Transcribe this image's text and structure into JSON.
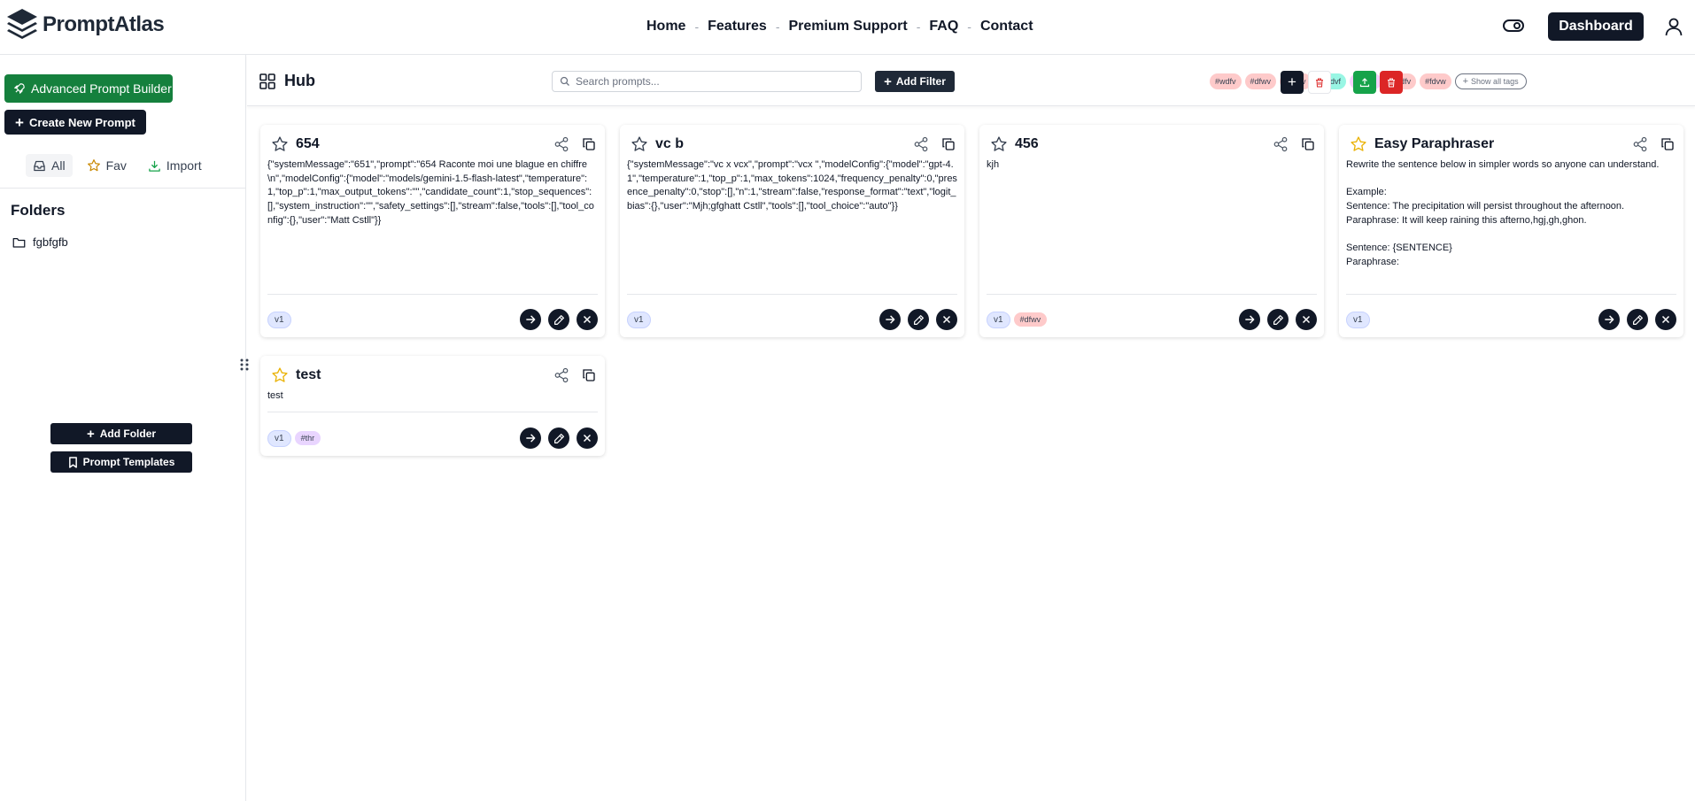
{
  "brand": {
    "name": "PromptAtlas"
  },
  "nav": {
    "links": [
      "Home",
      "Features",
      "Premium Support",
      "FAQ",
      "Contact"
    ],
    "separator": "-",
    "dashboard_label": "Dashboard"
  },
  "sidebar": {
    "advanced_builder_label": "Advanced Prompt Builder",
    "create_prompt_label": "Create New Prompt",
    "tabs": [
      {
        "label": "All",
        "icon": "inbox-icon"
      },
      {
        "label": "Fav",
        "icon": "star-icon"
      },
      {
        "label": "Import",
        "icon": "download-icon"
      }
    ],
    "folders_title": "Folders",
    "folders": [
      "fgbfgfb"
    ],
    "add_folder_label": "Add Folder",
    "templates_label": "Prompt Templates"
  },
  "hub": {
    "title": "Hub",
    "search_placeholder": "Search prompts...",
    "add_filter_label": "Add Filter",
    "tags": [
      {
        "label": "#wdfv",
        "color": "#fecaca"
      },
      {
        "label": "#dfwv",
        "color": "#fecaca"
      },
      {
        "label": "#wdfv",
        "color": "#fecaca"
      },
      {
        "label": "#wdvf",
        "color": "#99f6e4"
      },
      {
        "label": "#dwfv",
        "color": "#f5d0fe"
      },
      {
        "label": "#wdfv",
        "color": "#fecaca"
      },
      {
        "label": "#fdvw",
        "color": "#fecaca"
      }
    ],
    "show_all_label": "Show all tags"
  },
  "cards": [
    {
      "title": "654",
      "favorite": false,
      "body": "{\"systemMessage\":\"651\",\"prompt\":\"654 Raconte moi une blague en chiffre \\n\",\"modelConfig\":{\"model\":\"models/gemini-1.5-flash-latest\",\"temperature\":1,\"top_p\":1,\"max_output_tokens\":\"\",\"candidate_count\":1,\"stop_sequences\":[],\"system_instruction\":\"\",\"safety_settings\":[],\"stream\":false,\"tools\":[],\"tool_config\":{},\"user\":\"Matt Cstll\"}}",
      "version": "v1",
      "tags": []
    },
    {
      "title": "vc b",
      "favorite": false,
      "body": "{\"systemMessage\":\"vc x vcx\",\"prompt\":\"vcx \",\"modelConfig\":{\"model\":\"gpt-4.1\",\"temperature\":1,\"top_p\":1,\"max_tokens\":1024,\"frequency_penalty\":0,\"presence_penalty\":0,\"stop\":[],\"n\":1,\"stream\":false,\"response_format\":\"text\",\"logit_bias\":{},\"user\":\"Mjh;gfghatt Cstll\",\"tools\":[],\"tool_choice\":\"auto\"}}",
      "version": "v1",
      "tags": []
    },
    {
      "title": "456",
      "favorite": false,
      "body": "kjh",
      "version": "v1",
      "tags": [
        {
          "label": "#dfwv",
          "color": "#fecaca"
        }
      ]
    },
    {
      "title": "Easy Paraphraser",
      "favorite": true,
      "body": "Rewrite the sentence below in simpler words so anyone can understand.\n\nExample:\nSentence: The precipitation will persist throughout the afternoon.\nParaphrase: It will keep raining this afterno,hgj,gh,ghon.\n\nSentence: {SENTENCE}\nParaphrase:",
      "version": "v1",
      "tags": []
    },
    {
      "title": "test",
      "favorite": true,
      "body": "test",
      "version": "v1",
      "tags": [
        {
          "label": "#thr",
          "color": "#e9d5ff"
        }
      ]
    }
  ],
  "colors": {
    "accent": "#111827",
    "green": "#15803d",
    "red": "#dc2626",
    "star_fav": "#eab308"
  }
}
